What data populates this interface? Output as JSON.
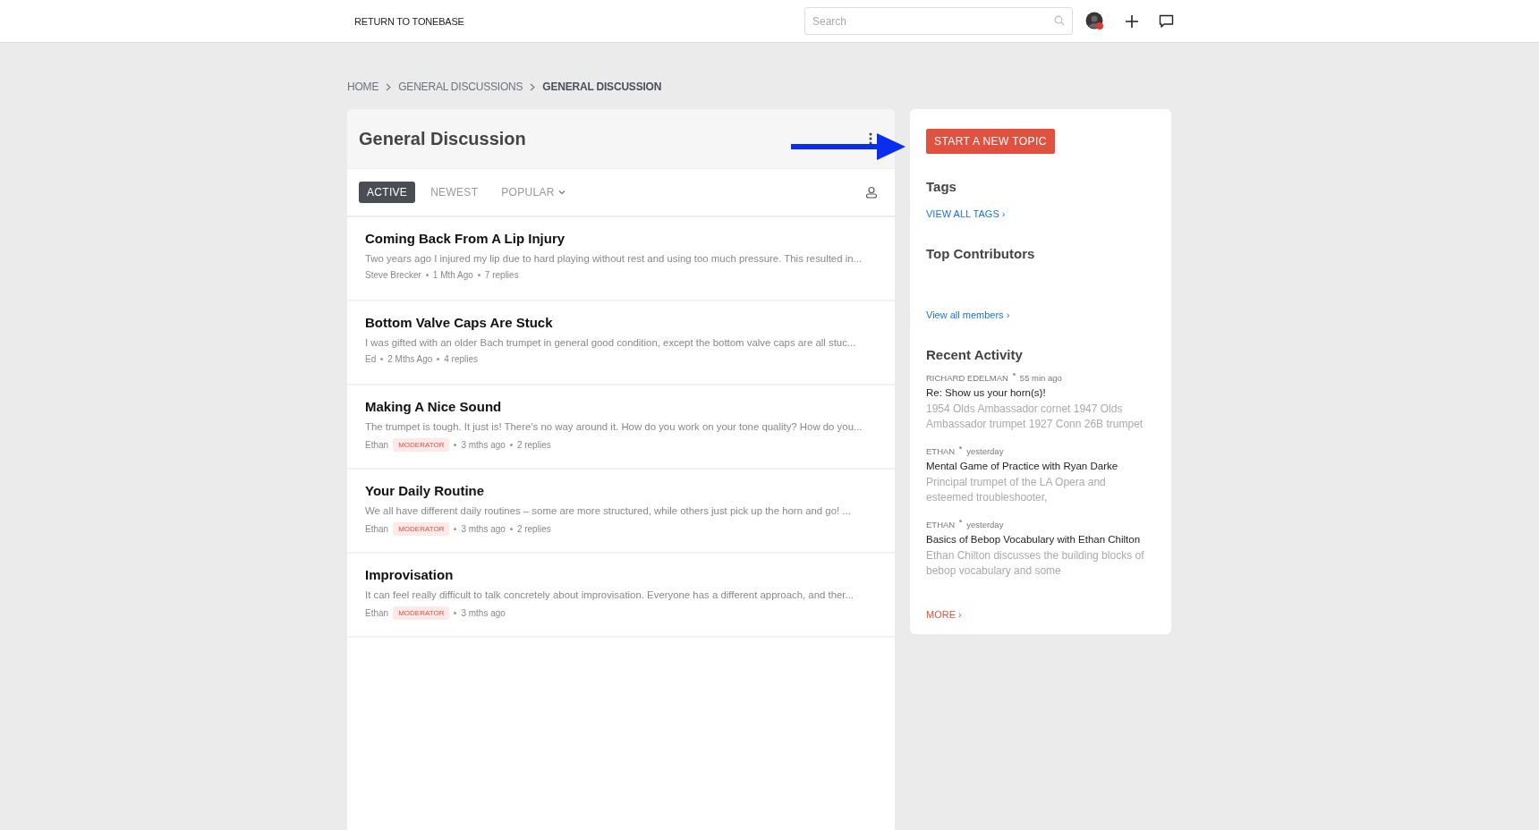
{
  "topbar": {
    "return_link": "RETURN TO TONEBASE",
    "search": {
      "placeholder": "Search"
    }
  },
  "breadcrumb": [
    {
      "label": "HOME",
      "current": false
    },
    {
      "label": "GENERAL DISCUSSIONS",
      "current": false
    },
    {
      "label": "GENERAL DISCUSSION",
      "current": true
    }
  ],
  "forum": {
    "title": "General Discussion",
    "tabs": [
      {
        "label": "ACTIVE",
        "selected": true,
        "dropdown": false
      },
      {
        "label": "NEWEST",
        "selected": false,
        "dropdown": false
      },
      {
        "label": "POPULAR",
        "selected": false,
        "dropdown": true
      }
    ],
    "topics": [
      {
        "title": "Coming Back From A Lip Injury",
        "excerpt": "Two years ago I injured my lip due to hard playing without rest and using too much pressure. This resulted in...",
        "author": "Steve Brecker",
        "time": "1 Mth Ago",
        "replies": "7 replies"
      },
      {
        "title": "Bottom Valve Caps Are Stuck",
        "excerpt": "I was gifted with an older Bach trumpet in general good condition, except the bottom valve caps are all stuc...",
        "author": "Ed",
        "time": "2 Mths Ago",
        "replies": "4 replies"
      },
      {
        "title": "Making A Nice Sound",
        "excerpt": "The trumpet is tough. It just is! There’s no way around it. How do you work on your tone quality? How do you...",
        "author": "Ethan",
        "badge": "MODERATOR",
        "time": "3 mths ago",
        "replies": "2 replies"
      },
      {
        "title": "Your Daily Routine",
        "excerpt": "We all have different daily routines – some are more structured, while others just pick up the horn and go! ...",
        "author": "Ethan",
        "badge": "MODERATOR",
        "time": "3 mths ago",
        "replies": "2 replies"
      },
      {
        "title": "Improvisation",
        "excerpt": "It can feel really difficult to talk concretely about improvisation. Everyone has a different approach, and ther...",
        "author": "Ethan",
        "badge": "MODERATOR",
        "time": "3 mths ago"
      }
    ]
  },
  "sidebar": {
    "button": "START A NEW TOPIC",
    "tags": {
      "heading": "Tags",
      "link": "VIEW ALL TAGS ›"
    },
    "contributors": {
      "heading": "Top Contributors",
      "link": "View all members ›"
    },
    "recent": {
      "heading": "Recent Activity",
      "items": [
        {
          "author": "RICHARD EDELMAN",
          "time": "55 min ago",
          "title": "Re: Show us your horn(s)!",
          "excerpt": "1954 Olds Ambassador cornet 1947 Olds Ambassador trumpet 1927 Conn 26B trumpet"
        },
        {
          "author": "ETHAN",
          "time": "yesterday",
          "title": "Mental Game of Practice with Ryan Darke",
          "excerpt": "Principal trumpet of the LA Opera and esteemed troubleshooter,"
        },
        {
          "author": "ETHAN",
          "time": "yesterday",
          "title": "Basics of Bebop Vocabulary with Ethan Chilton",
          "excerpt": "Ethan Chilton discusses the building blocks of bebop vocabulary and some"
        }
      ],
      "more": "MORE ›"
    }
  }
}
